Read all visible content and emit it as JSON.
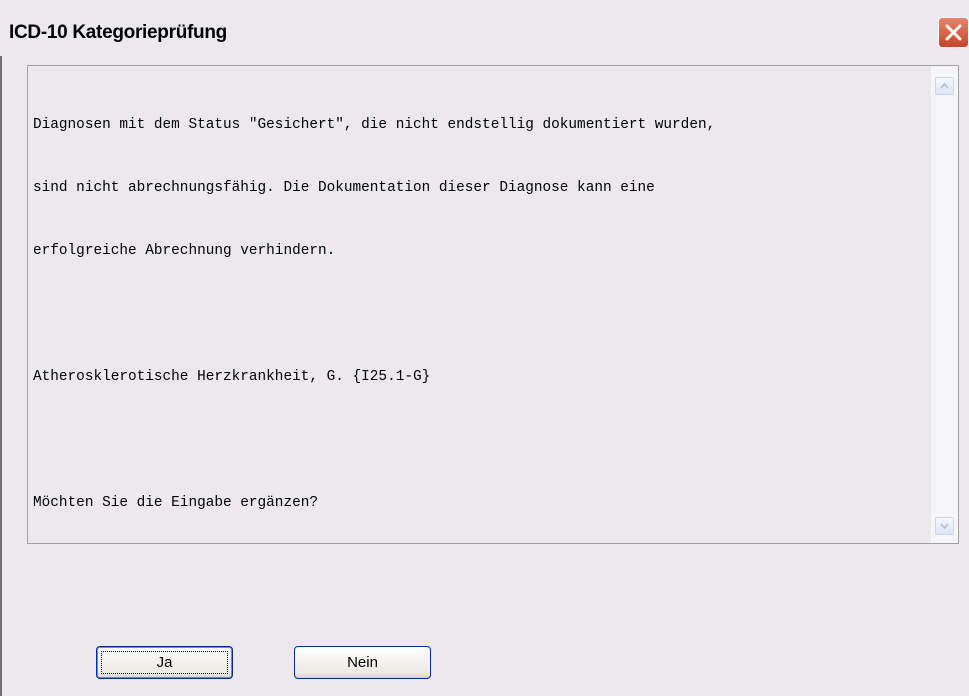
{
  "window": {
    "title": "ICD-10 Kategorieprüfung"
  },
  "message": {
    "lines": [
      "Diagnosen mit dem Status \"Gesichert\", die nicht endstellig dokumentiert wurden,",
      "sind nicht abrechnungsfähig. Die Dokumentation dieser Diagnose kann eine",
      "erfolgreiche Abrechnung verhindern.",
      "",
      "Atherosklerotische Herzkrankheit, G. {I25.1-G}",
      "",
      "Möchten Sie die Eingabe ergänzen?"
    ]
  },
  "buttons": {
    "yes_label": "Ja",
    "no_label": "Nein"
  },
  "icons": {
    "close": "close-icon",
    "scroll_up": "scroll-up-arrow-icon",
    "scroll_down": "scroll-down-arrow-icon"
  },
  "colors": {
    "close_button": "#c9452b",
    "window_bg": "#ebe9ed",
    "button_border": "#002d96"
  }
}
